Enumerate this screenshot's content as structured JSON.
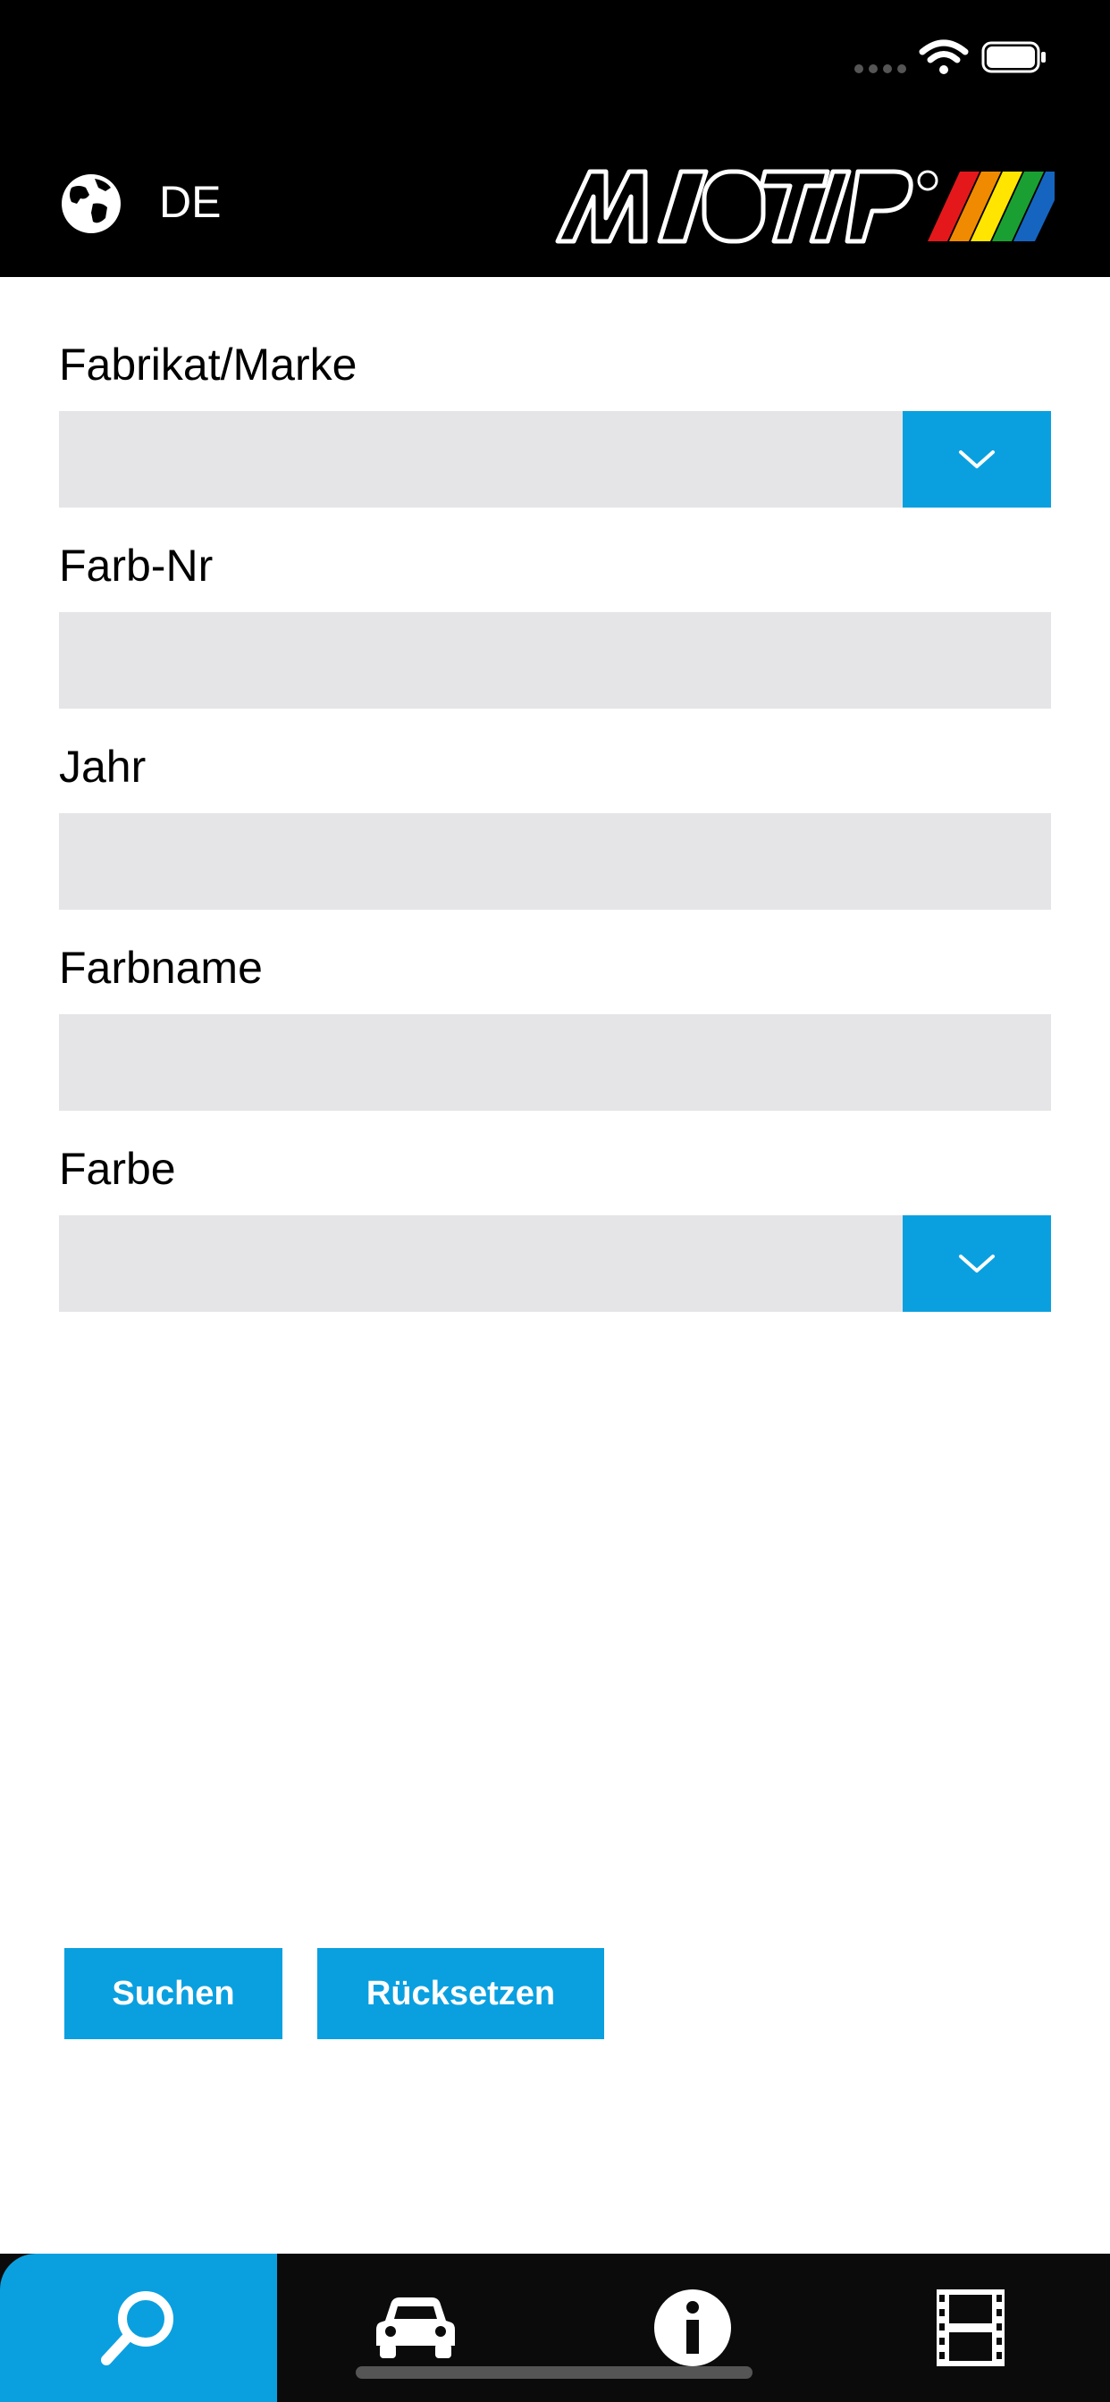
{
  "header": {
    "language": "DE",
    "logo_text": "MOTIP"
  },
  "form": {
    "brand": {
      "label": "Fabrikat/Marke",
      "value": ""
    },
    "color_no": {
      "label": "Farb-Nr",
      "value": ""
    },
    "year": {
      "label": "Jahr",
      "value": ""
    },
    "color_name": {
      "label": "Farbname",
      "value": ""
    },
    "color": {
      "label": "Farbe",
      "value": ""
    }
  },
  "buttons": {
    "search": "Suchen",
    "reset": "Rücksetzen"
  },
  "tabs": [
    {
      "icon": "search-icon",
      "active": true
    },
    {
      "icon": "car-icon",
      "active": false
    },
    {
      "icon": "info-icon",
      "active": false
    },
    {
      "icon": "film-icon",
      "active": false
    }
  ],
  "colors": {
    "accent": "#0aa0e0",
    "field_bg": "#e5e5e7",
    "header_bg": "#000000"
  }
}
